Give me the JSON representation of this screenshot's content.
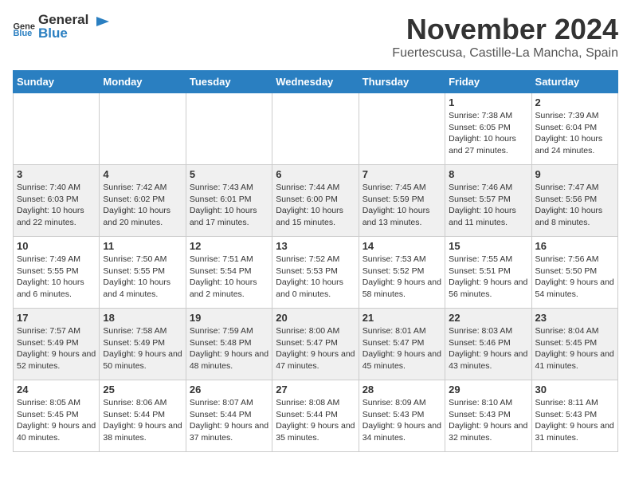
{
  "header": {
    "logo_general": "General",
    "logo_blue": "Blue",
    "month_year": "November 2024",
    "location": "Fuertescusa, Castille-La Mancha, Spain"
  },
  "weekdays": [
    "Sunday",
    "Monday",
    "Tuesday",
    "Wednesday",
    "Thursday",
    "Friday",
    "Saturday"
  ],
  "weeks": [
    [
      {
        "day": "",
        "sunrise": "",
        "sunset": "",
        "daylight": ""
      },
      {
        "day": "",
        "sunrise": "",
        "sunset": "",
        "daylight": ""
      },
      {
        "day": "",
        "sunrise": "",
        "sunset": "",
        "daylight": ""
      },
      {
        "day": "",
        "sunrise": "",
        "sunset": "",
        "daylight": ""
      },
      {
        "day": "",
        "sunrise": "",
        "sunset": "",
        "daylight": ""
      },
      {
        "day": "1",
        "sunrise": "Sunrise: 7:38 AM",
        "sunset": "Sunset: 6:05 PM",
        "daylight": "Daylight: 10 hours and 27 minutes."
      },
      {
        "day": "2",
        "sunrise": "Sunrise: 7:39 AM",
        "sunset": "Sunset: 6:04 PM",
        "daylight": "Daylight: 10 hours and 24 minutes."
      }
    ],
    [
      {
        "day": "3",
        "sunrise": "Sunrise: 7:40 AM",
        "sunset": "Sunset: 6:03 PM",
        "daylight": "Daylight: 10 hours and 22 minutes."
      },
      {
        "day": "4",
        "sunrise": "Sunrise: 7:42 AM",
        "sunset": "Sunset: 6:02 PM",
        "daylight": "Daylight: 10 hours and 20 minutes."
      },
      {
        "day": "5",
        "sunrise": "Sunrise: 7:43 AM",
        "sunset": "Sunset: 6:01 PM",
        "daylight": "Daylight: 10 hours and 17 minutes."
      },
      {
        "day": "6",
        "sunrise": "Sunrise: 7:44 AM",
        "sunset": "Sunset: 6:00 PM",
        "daylight": "Daylight: 10 hours and 15 minutes."
      },
      {
        "day": "7",
        "sunrise": "Sunrise: 7:45 AM",
        "sunset": "Sunset: 5:59 PM",
        "daylight": "Daylight: 10 hours and 13 minutes."
      },
      {
        "day": "8",
        "sunrise": "Sunrise: 7:46 AM",
        "sunset": "Sunset: 5:57 PM",
        "daylight": "Daylight: 10 hours and 11 minutes."
      },
      {
        "day": "9",
        "sunrise": "Sunrise: 7:47 AM",
        "sunset": "Sunset: 5:56 PM",
        "daylight": "Daylight: 10 hours and 8 minutes."
      }
    ],
    [
      {
        "day": "10",
        "sunrise": "Sunrise: 7:49 AM",
        "sunset": "Sunset: 5:55 PM",
        "daylight": "Daylight: 10 hours and 6 minutes."
      },
      {
        "day": "11",
        "sunrise": "Sunrise: 7:50 AM",
        "sunset": "Sunset: 5:55 PM",
        "daylight": "Daylight: 10 hours and 4 minutes."
      },
      {
        "day": "12",
        "sunrise": "Sunrise: 7:51 AM",
        "sunset": "Sunset: 5:54 PM",
        "daylight": "Daylight: 10 hours and 2 minutes."
      },
      {
        "day": "13",
        "sunrise": "Sunrise: 7:52 AM",
        "sunset": "Sunset: 5:53 PM",
        "daylight": "Daylight: 10 hours and 0 minutes."
      },
      {
        "day": "14",
        "sunrise": "Sunrise: 7:53 AM",
        "sunset": "Sunset: 5:52 PM",
        "daylight": "Daylight: 9 hours and 58 minutes."
      },
      {
        "day": "15",
        "sunrise": "Sunrise: 7:55 AM",
        "sunset": "Sunset: 5:51 PM",
        "daylight": "Daylight: 9 hours and 56 minutes."
      },
      {
        "day": "16",
        "sunrise": "Sunrise: 7:56 AM",
        "sunset": "Sunset: 5:50 PM",
        "daylight": "Daylight: 9 hours and 54 minutes."
      }
    ],
    [
      {
        "day": "17",
        "sunrise": "Sunrise: 7:57 AM",
        "sunset": "Sunset: 5:49 PM",
        "daylight": "Daylight: 9 hours and 52 minutes."
      },
      {
        "day": "18",
        "sunrise": "Sunrise: 7:58 AM",
        "sunset": "Sunset: 5:49 PM",
        "daylight": "Daylight: 9 hours and 50 minutes."
      },
      {
        "day": "19",
        "sunrise": "Sunrise: 7:59 AM",
        "sunset": "Sunset: 5:48 PM",
        "daylight": "Daylight: 9 hours and 48 minutes."
      },
      {
        "day": "20",
        "sunrise": "Sunrise: 8:00 AM",
        "sunset": "Sunset: 5:47 PM",
        "daylight": "Daylight: 9 hours and 47 minutes."
      },
      {
        "day": "21",
        "sunrise": "Sunrise: 8:01 AM",
        "sunset": "Sunset: 5:47 PM",
        "daylight": "Daylight: 9 hours and 45 minutes."
      },
      {
        "day": "22",
        "sunrise": "Sunrise: 8:03 AM",
        "sunset": "Sunset: 5:46 PM",
        "daylight": "Daylight: 9 hours and 43 minutes."
      },
      {
        "day": "23",
        "sunrise": "Sunrise: 8:04 AM",
        "sunset": "Sunset: 5:45 PM",
        "daylight": "Daylight: 9 hours and 41 minutes."
      }
    ],
    [
      {
        "day": "24",
        "sunrise": "Sunrise: 8:05 AM",
        "sunset": "Sunset: 5:45 PM",
        "daylight": "Daylight: 9 hours and 40 minutes."
      },
      {
        "day": "25",
        "sunrise": "Sunrise: 8:06 AM",
        "sunset": "Sunset: 5:44 PM",
        "daylight": "Daylight: 9 hours and 38 minutes."
      },
      {
        "day": "26",
        "sunrise": "Sunrise: 8:07 AM",
        "sunset": "Sunset: 5:44 PM",
        "daylight": "Daylight: 9 hours and 37 minutes."
      },
      {
        "day": "27",
        "sunrise": "Sunrise: 8:08 AM",
        "sunset": "Sunset: 5:44 PM",
        "daylight": "Daylight: 9 hours and 35 minutes."
      },
      {
        "day": "28",
        "sunrise": "Sunrise: 8:09 AM",
        "sunset": "Sunset: 5:43 PM",
        "daylight": "Daylight: 9 hours and 34 minutes."
      },
      {
        "day": "29",
        "sunrise": "Sunrise: 8:10 AM",
        "sunset": "Sunset: 5:43 PM",
        "daylight": "Daylight: 9 hours and 32 minutes."
      },
      {
        "day": "30",
        "sunrise": "Sunrise: 8:11 AM",
        "sunset": "Sunset: 5:43 PM",
        "daylight": "Daylight: 9 hours and 31 minutes."
      }
    ]
  ]
}
